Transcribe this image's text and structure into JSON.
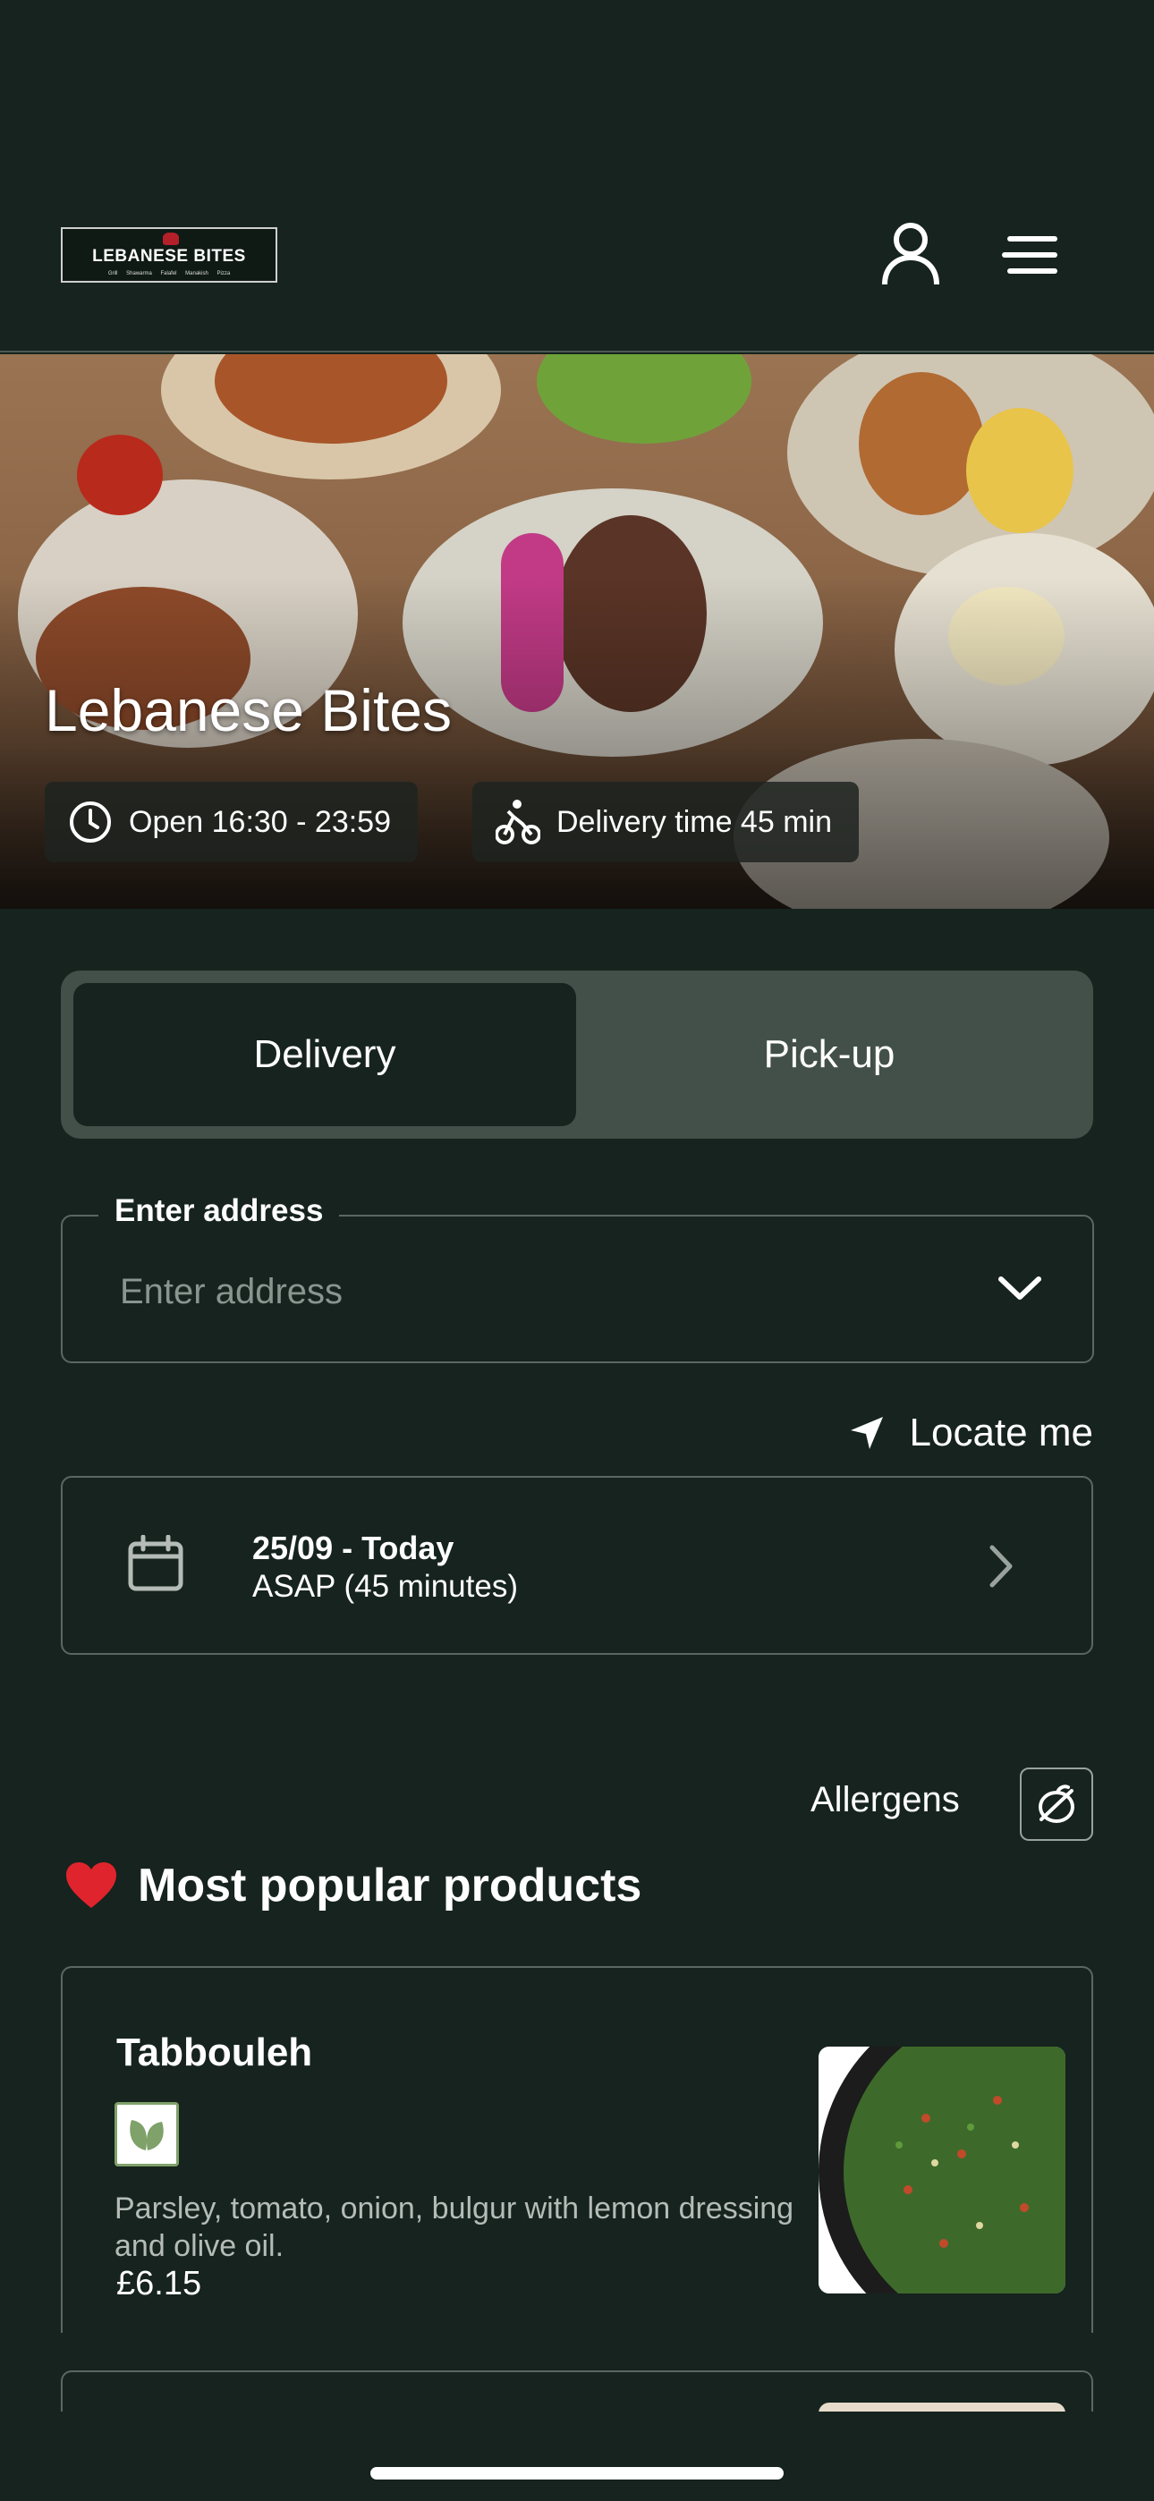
{
  "header": {
    "logo_text": "LEBANESE BITES",
    "logo_subtitle": "Grill  Shawarma  Falafel  Manakish  Pizza",
    "user_icon": "user-icon",
    "menu_icon": "hamburger-menu-icon"
  },
  "hero": {
    "title": "Lebanese Bites",
    "open_hours": "Open 16:30 - 23:59",
    "delivery_time": "Delivery time 45 min",
    "clock_icon": "clock-icon",
    "bike_icon": "cyclist-icon"
  },
  "order_mode": {
    "options": [
      {
        "label": "Delivery",
        "active": true
      },
      {
        "label": "Pick-up",
        "active": false
      }
    ]
  },
  "address": {
    "legend": "Enter address",
    "placeholder": "Enter address"
  },
  "locate": {
    "label": "Locate me"
  },
  "schedule": {
    "date": "25/09 - Today",
    "time": "ASAP (45 minutes)"
  },
  "allergens": {
    "label": "Allergens"
  },
  "popular": {
    "title": "Most popular products",
    "products": [
      {
        "name": "Tabbouleh",
        "description": "Parsley, tomato, onion, bulgur with lemon dressing and olive oil.",
        "price": "£6.15",
        "badge_icon": "vegan-leaf-icon"
      }
    ]
  },
  "colors": {
    "background": "#16231e",
    "toggle_bg": "#435049",
    "border": "#5a6862"
  }
}
